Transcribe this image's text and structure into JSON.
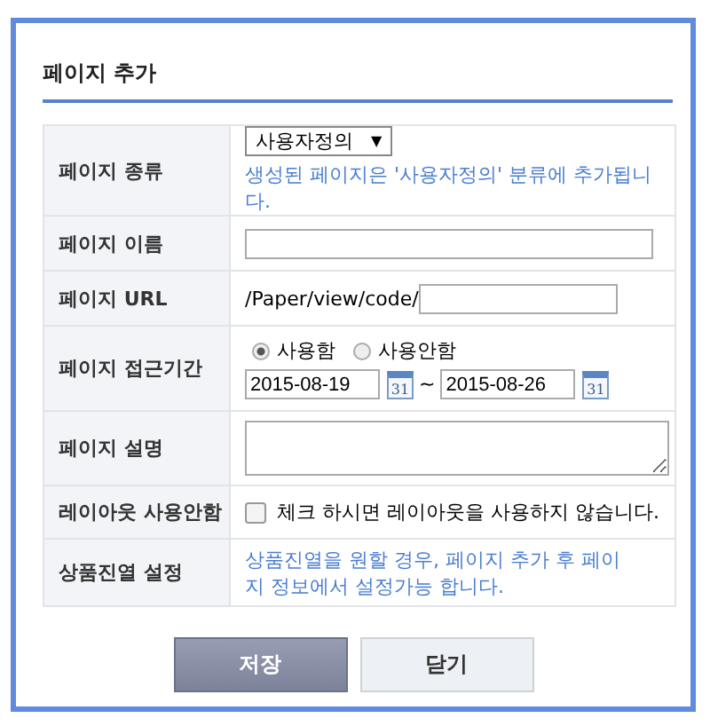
{
  "title": "페이지 추가",
  "rows": [
    {
      "kind": "select",
      "label": "페이지 종류",
      "value": "사용자정의",
      "arrow": "▼",
      "note": "생성된 페이지은 '사용자정의' 분류에 추가됩니다."
    },
    {
      "kind": "text",
      "label": "페이지 이름"
    },
    {
      "kind": "url",
      "label": "페이지 URL",
      "prefix": "/Paper/view/code/"
    },
    {
      "kind": "period",
      "label": "페이지 접근기간",
      "options": [
        {
          "label": "사용함",
          "selected": true
        },
        {
          "label": "사용안함",
          "selected": false
        }
      ],
      "from": "2015-08-19",
      "from_calendar": "31",
      "separator": "~",
      "to": "2015-08-26",
      "to_calendar": "31"
    },
    {
      "kind": "textarea",
      "label": "페이지 설명"
    },
    {
      "kind": "checkbox",
      "label": "레이아웃 사용안함",
      "text": "체크 하시면 레이아웃을 사용하지 않습니다.",
      "checked": false
    },
    {
      "kind": "note",
      "label": "상품진열 설정",
      "note": "상품진열을 원할 경우, 페이지 추가 후 페이지 정보에서 설정가능 합니다."
    }
  ],
  "buttons": [
    {
      "label": "저장",
      "kind": "primary"
    },
    {
      "label": "닫기",
      "kind": "secondary"
    }
  ]
}
